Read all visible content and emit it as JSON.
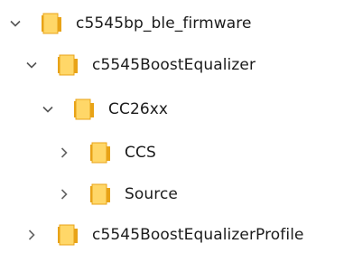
{
  "colors": {
    "folder_back": "#e8a317",
    "folder_front": "#ffd768",
    "chevron": "#555555",
    "text": "#1b1b1b"
  },
  "tree": {
    "items": [
      {
        "label": "c5545bp_ble_firmware",
        "state": "expanded",
        "icon": "folder-icon"
      },
      {
        "label": "c5545BoostEqualizer",
        "state": "expanded",
        "icon": "folder-icon"
      },
      {
        "label": "CC26xx",
        "state": "expanded",
        "icon": "folder-icon"
      },
      {
        "label": "CCS",
        "state": "collapsed",
        "icon": "folder-icon"
      },
      {
        "label": "Source",
        "state": "collapsed",
        "icon": "folder-icon"
      },
      {
        "label": "c5545BoostEqualizerProfile",
        "state": "collapsed",
        "icon": "folder-icon"
      }
    ]
  }
}
